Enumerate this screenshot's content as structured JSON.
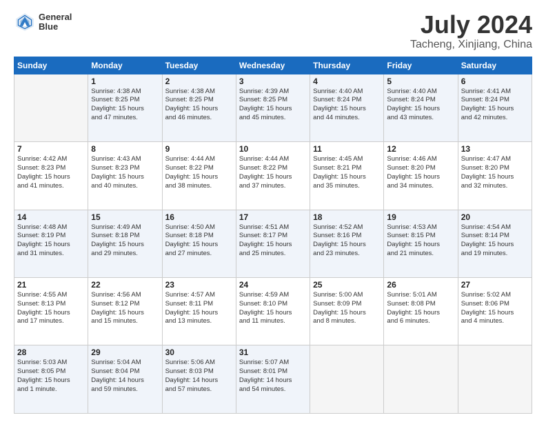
{
  "logo": {
    "line1": "General",
    "line2": "Blue"
  },
  "title": "July 2024",
  "subtitle": "Tacheng, Xinjiang, China",
  "days_of_week": [
    "Sunday",
    "Monday",
    "Tuesday",
    "Wednesday",
    "Thursday",
    "Friday",
    "Saturday"
  ],
  "weeks": [
    [
      {
        "day": "",
        "info": ""
      },
      {
        "day": "1",
        "info": "Sunrise: 4:38 AM\nSunset: 8:25 PM\nDaylight: 15 hours\nand 47 minutes."
      },
      {
        "day": "2",
        "info": "Sunrise: 4:38 AM\nSunset: 8:25 PM\nDaylight: 15 hours\nand 46 minutes."
      },
      {
        "day": "3",
        "info": "Sunrise: 4:39 AM\nSunset: 8:25 PM\nDaylight: 15 hours\nand 45 minutes."
      },
      {
        "day": "4",
        "info": "Sunrise: 4:40 AM\nSunset: 8:24 PM\nDaylight: 15 hours\nand 44 minutes."
      },
      {
        "day": "5",
        "info": "Sunrise: 4:40 AM\nSunset: 8:24 PM\nDaylight: 15 hours\nand 43 minutes."
      },
      {
        "day": "6",
        "info": "Sunrise: 4:41 AM\nSunset: 8:24 PM\nDaylight: 15 hours\nand 42 minutes."
      }
    ],
    [
      {
        "day": "7",
        "info": "Sunrise: 4:42 AM\nSunset: 8:23 PM\nDaylight: 15 hours\nand 41 minutes."
      },
      {
        "day": "8",
        "info": "Sunrise: 4:43 AM\nSunset: 8:23 PM\nDaylight: 15 hours\nand 40 minutes."
      },
      {
        "day": "9",
        "info": "Sunrise: 4:44 AM\nSunset: 8:22 PM\nDaylight: 15 hours\nand 38 minutes."
      },
      {
        "day": "10",
        "info": "Sunrise: 4:44 AM\nSunset: 8:22 PM\nDaylight: 15 hours\nand 37 minutes."
      },
      {
        "day": "11",
        "info": "Sunrise: 4:45 AM\nSunset: 8:21 PM\nDaylight: 15 hours\nand 35 minutes."
      },
      {
        "day": "12",
        "info": "Sunrise: 4:46 AM\nSunset: 8:20 PM\nDaylight: 15 hours\nand 34 minutes."
      },
      {
        "day": "13",
        "info": "Sunrise: 4:47 AM\nSunset: 8:20 PM\nDaylight: 15 hours\nand 32 minutes."
      }
    ],
    [
      {
        "day": "14",
        "info": "Sunrise: 4:48 AM\nSunset: 8:19 PM\nDaylight: 15 hours\nand 31 minutes."
      },
      {
        "day": "15",
        "info": "Sunrise: 4:49 AM\nSunset: 8:18 PM\nDaylight: 15 hours\nand 29 minutes."
      },
      {
        "day": "16",
        "info": "Sunrise: 4:50 AM\nSunset: 8:18 PM\nDaylight: 15 hours\nand 27 minutes."
      },
      {
        "day": "17",
        "info": "Sunrise: 4:51 AM\nSunset: 8:17 PM\nDaylight: 15 hours\nand 25 minutes."
      },
      {
        "day": "18",
        "info": "Sunrise: 4:52 AM\nSunset: 8:16 PM\nDaylight: 15 hours\nand 23 minutes."
      },
      {
        "day": "19",
        "info": "Sunrise: 4:53 AM\nSunset: 8:15 PM\nDaylight: 15 hours\nand 21 minutes."
      },
      {
        "day": "20",
        "info": "Sunrise: 4:54 AM\nSunset: 8:14 PM\nDaylight: 15 hours\nand 19 minutes."
      }
    ],
    [
      {
        "day": "21",
        "info": "Sunrise: 4:55 AM\nSunset: 8:13 PM\nDaylight: 15 hours\nand 17 minutes."
      },
      {
        "day": "22",
        "info": "Sunrise: 4:56 AM\nSunset: 8:12 PM\nDaylight: 15 hours\nand 15 minutes."
      },
      {
        "day": "23",
        "info": "Sunrise: 4:57 AM\nSunset: 8:11 PM\nDaylight: 15 hours\nand 13 minutes."
      },
      {
        "day": "24",
        "info": "Sunrise: 4:59 AM\nSunset: 8:10 PM\nDaylight: 15 hours\nand 11 minutes."
      },
      {
        "day": "25",
        "info": "Sunrise: 5:00 AM\nSunset: 8:09 PM\nDaylight: 15 hours\nand 8 minutes."
      },
      {
        "day": "26",
        "info": "Sunrise: 5:01 AM\nSunset: 8:08 PM\nDaylight: 15 hours\nand 6 minutes."
      },
      {
        "day": "27",
        "info": "Sunrise: 5:02 AM\nSunset: 8:06 PM\nDaylight: 15 hours\nand 4 minutes."
      }
    ],
    [
      {
        "day": "28",
        "info": "Sunrise: 5:03 AM\nSunset: 8:05 PM\nDaylight: 15 hours\nand 1 minute."
      },
      {
        "day": "29",
        "info": "Sunrise: 5:04 AM\nSunset: 8:04 PM\nDaylight: 14 hours\nand 59 minutes."
      },
      {
        "day": "30",
        "info": "Sunrise: 5:06 AM\nSunset: 8:03 PM\nDaylight: 14 hours\nand 57 minutes."
      },
      {
        "day": "31",
        "info": "Sunrise: 5:07 AM\nSunset: 8:01 PM\nDaylight: 14 hours\nand 54 minutes."
      },
      {
        "day": "",
        "info": ""
      },
      {
        "day": "",
        "info": ""
      },
      {
        "day": "",
        "info": ""
      }
    ]
  ]
}
